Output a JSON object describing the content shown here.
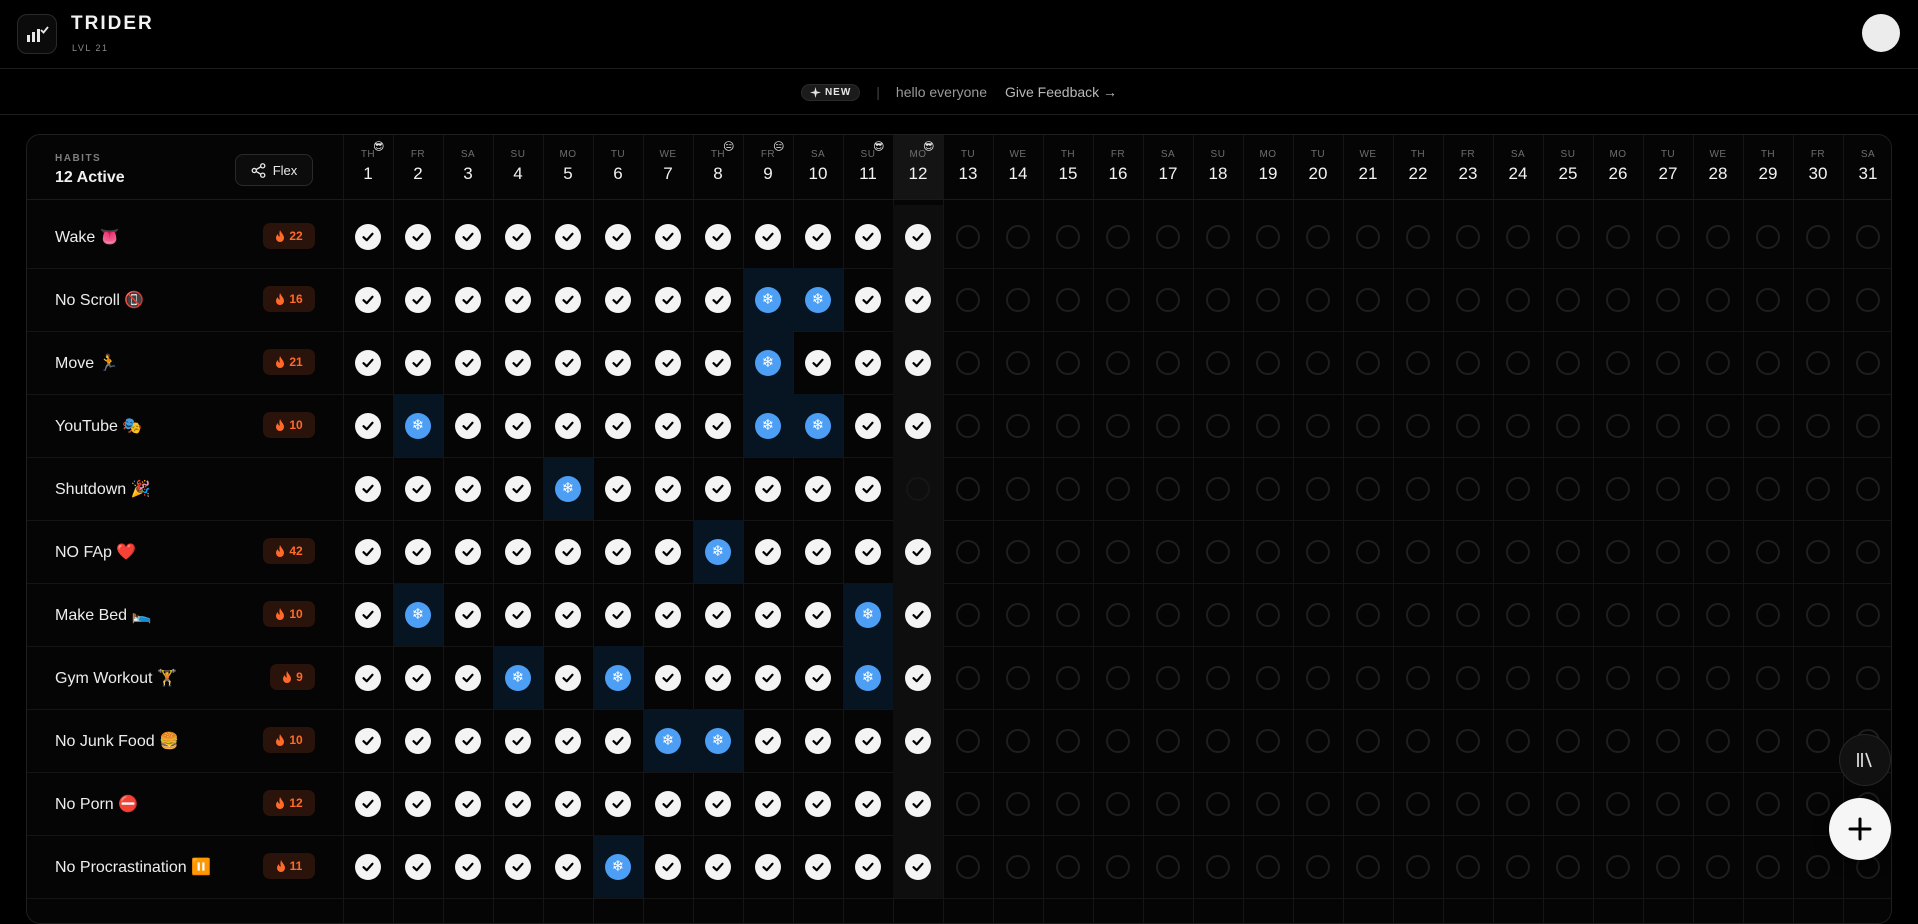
{
  "app": {
    "title": "TRIDER",
    "level": "LVL 21"
  },
  "announcement": {
    "badge": "NEW",
    "message": "hello everyone",
    "feedback": "Give Feedback",
    "feedback_arrow": "→"
  },
  "panel": {
    "caption": "HABITS",
    "active_count": "12 Active",
    "flex_label": "Flex"
  },
  "days": [
    {
      "dow": "TH",
      "num": "1",
      "mood": "😎"
    },
    {
      "dow": "FR",
      "num": "2"
    },
    {
      "dow": "SA",
      "num": "3"
    },
    {
      "dow": "SU",
      "num": "4"
    },
    {
      "dow": "MO",
      "num": "5"
    },
    {
      "dow": "TU",
      "num": "6"
    },
    {
      "dow": "WE",
      "num": "7"
    },
    {
      "dow": "TH",
      "num": "8",
      "mood": "😑"
    },
    {
      "dow": "FR",
      "num": "9",
      "mood": "😑"
    },
    {
      "dow": "SA",
      "num": "10"
    },
    {
      "dow": "SU",
      "num": "11",
      "mood": "😎"
    },
    {
      "dow": "MO",
      "num": "12",
      "mood": "😎",
      "today": true
    },
    {
      "dow": "TU",
      "num": "13"
    },
    {
      "dow": "WE",
      "num": "14"
    },
    {
      "dow": "TH",
      "num": "15"
    },
    {
      "dow": "FR",
      "num": "16"
    },
    {
      "dow": "SA",
      "num": "17"
    },
    {
      "dow": "SU",
      "num": "18"
    },
    {
      "dow": "MO",
      "num": "19"
    },
    {
      "dow": "TU",
      "num": "20"
    },
    {
      "dow": "WE",
      "num": "21"
    },
    {
      "dow": "TH",
      "num": "22"
    },
    {
      "dow": "FR",
      "num": "23"
    },
    {
      "dow": "SA",
      "num": "24"
    },
    {
      "dow": "SU",
      "num": "25"
    },
    {
      "dow": "MO",
      "num": "26"
    },
    {
      "dow": "TU",
      "num": "27"
    },
    {
      "dow": "WE",
      "num": "28"
    },
    {
      "dow": "TH",
      "num": "29"
    },
    {
      "dow": "FR",
      "num": "30"
    },
    {
      "dow": "SA",
      "num": "31"
    }
  ],
  "habits": [
    {
      "name": "Wake 👅",
      "streak": "22",
      "status": "DDDDDDDDDDDD"
    },
    {
      "name": "No Scroll 📵",
      "streak": "16",
      "status": "DDDDDDDDFFDD"
    },
    {
      "name": "Move 🏃",
      "streak": "21",
      "status": "DDDDDDDDFDDD"
    },
    {
      "name": "YouTube 🎭",
      "streak": "10",
      "status": "DFDDDDDDFFDD"
    },
    {
      "name": "Shutdown 🎉",
      "streak": "",
      "status": "DDDDFDDDDDDE"
    },
    {
      "name": "NO FAp ❤️",
      "streak": "42",
      "status": "DDDDDDDFDDDD"
    },
    {
      "name": "Make Bed 🛌",
      "streak": "10",
      "status": "DFDDDDDDDDFD"
    },
    {
      "name": "Gym Workout 🏋",
      "streak": "9",
      "status": "DDDFDFDDDDFD"
    },
    {
      "name": "No Junk Food 🍔",
      "streak": "10",
      "status": "DDDDDDFFDDDD"
    },
    {
      "name": "No Porn ⛔",
      "streak": "12",
      "status": "DDDDDDDDDDDD"
    },
    {
      "name": "No Procrastination ⏸️",
      "streak": "11",
      "status": "DDDDDFDDDDDD"
    }
  ],
  "colors": {
    "background": "#000000",
    "done": "#f4f4f4",
    "freeze": "#4d9ef5",
    "streak": "#ff6a2a"
  },
  "icons": {
    "done": "check-icon",
    "freeze": "snowflake-icon",
    "streak": "flame-icon",
    "add": "plus-icon",
    "library": "library-icon",
    "share": "share-icon"
  }
}
